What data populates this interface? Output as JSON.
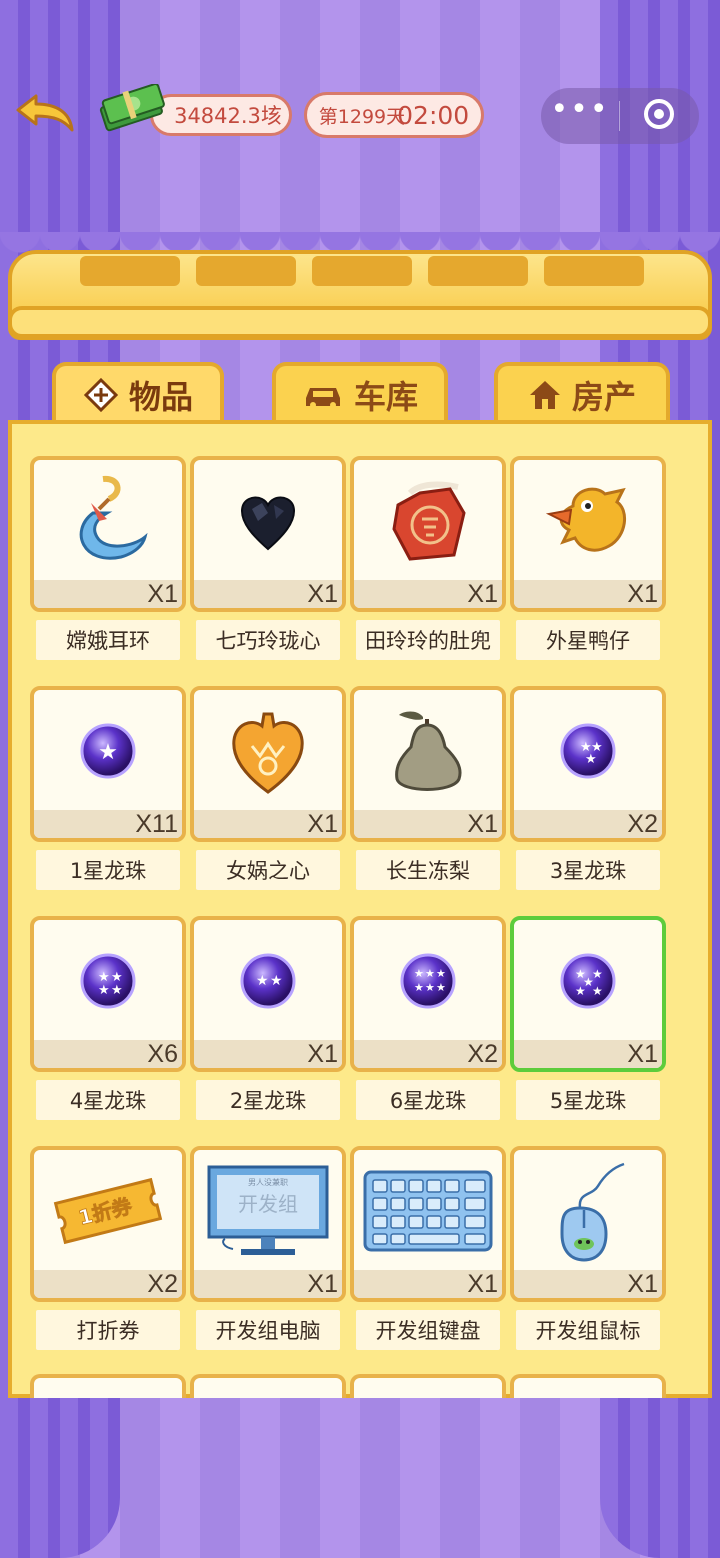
{
  "status": {
    "money": "34842.3垓",
    "day": "第1299天",
    "time": "02:00"
  },
  "tabs": [
    {
      "label": "物品",
      "icon": "gem-icon",
      "active": true
    },
    {
      "label": "车库",
      "icon": "car-icon",
      "active": false
    },
    {
      "label": "房产",
      "icon": "house-icon",
      "active": false
    }
  ],
  "items": [
    {
      "name": "嫦娥耳环",
      "count": "X1",
      "icon": "earring-icon"
    },
    {
      "name": "七巧玲珑心",
      "count": "X1",
      "icon": "black-heart-gem-icon"
    },
    {
      "name": "田玲玲的肚兜",
      "count": "X1",
      "icon": "apron-icon"
    },
    {
      "name": "外星鸭仔",
      "count": "X1",
      "icon": "duck-icon"
    },
    {
      "name": "1星龙珠",
      "count": "X11",
      "icon": "dragon-ball-icon"
    },
    {
      "name": "女娲之心",
      "count": "X1",
      "icon": "golden-heart-icon"
    },
    {
      "name": "长生冻梨",
      "count": "X1",
      "icon": "pear-icon"
    },
    {
      "name": "3星龙珠",
      "count": "X2",
      "icon": "dragon-ball-icon"
    },
    {
      "name": "4星龙珠",
      "count": "X6",
      "icon": "dragon-ball-icon"
    },
    {
      "name": "2星龙珠",
      "count": "X1",
      "icon": "dragon-ball-icon"
    },
    {
      "name": "6星龙珠",
      "count": "X2",
      "icon": "dragon-ball-icon"
    },
    {
      "name": "5星龙珠",
      "count": "X1",
      "icon": "dragon-ball-icon",
      "selected": true
    },
    {
      "name": "打折券",
      "count": "X2",
      "icon": "coupon-icon"
    },
    {
      "name": "开发组电脑",
      "count": "X1",
      "icon": "monitor-icon"
    },
    {
      "name": "开发组键盘",
      "count": "X1",
      "icon": "keypad-icon"
    },
    {
      "name": "开发组鼠标",
      "count": "X1",
      "icon": "mouse-icon"
    }
  ],
  "artwork_text": {
    "coupon": "1折券",
    "monitor_caption": "开发组",
    "monitor_header": "男人没兼职"
  },
  "colors": {
    "selected_border": "#5dcc3c",
    "card_border": "#e8b24a",
    "panel_bg": "#fde98a",
    "money_text": "#c34a3e"
  }
}
